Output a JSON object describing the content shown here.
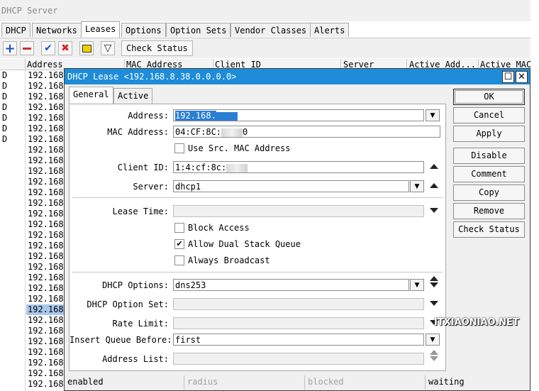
{
  "window": {
    "title": "DHCP Server"
  },
  "tabs": [
    "DHCP",
    "Networks",
    "Leases",
    "Options",
    "Option Sets",
    "Vendor Classes",
    "Alerts"
  ],
  "toolbar": {
    "icons": [
      "add-icon",
      "remove-icon",
      "enable-check-icon",
      "disable-x-icon",
      "comment-icon",
      "filter-icon"
    ],
    "check_status_label": "Check Status",
    "colors": {
      "add": "#1a4fc4",
      "remove": "#d03030",
      "enable": "#1a4fc4",
      "disable": "#e02020",
      "comment": "#f0d000"
    }
  },
  "columns": [
    "Address",
    "MAC Address",
    "Client ID",
    "Server",
    "Active Add...",
    "Active MAC"
  ],
  "rows": [
    {
      "flag": "D",
      "address": "192.168"
    },
    {
      "flag": "D",
      "address": "192.168"
    },
    {
      "flag": "D",
      "address": "192.168"
    },
    {
      "flag": "D",
      "address": "192.168"
    },
    {
      "flag": "D",
      "address": "192.168"
    },
    {
      "flag": "D",
      "address": "192.168"
    },
    {
      "flag": "D",
      "address": "192.168"
    },
    {
      "flag": "",
      "address": "192.168"
    },
    {
      "flag": "",
      "address": "192.168"
    },
    {
      "flag": "",
      "address": "192.168"
    },
    {
      "flag": "",
      "address": "192.168"
    },
    {
      "flag": "",
      "address": "192.168"
    },
    {
      "flag": "",
      "address": "192.168"
    },
    {
      "flag": "",
      "address": "192.168"
    },
    {
      "flag": "",
      "address": "192.168"
    },
    {
      "flag": "",
      "address": "192.168"
    },
    {
      "flag": "",
      "address": "192.168"
    },
    {
      "flag": "",
      "address": "192.168"
    },
    {
      "flag": "",
      "address": "192.168"
    },
    {
      "flag": "",
      "address": "192.168"
    },
    {
      "flag": "",
      "address": "192.168"
    },
    {
      "flag": "",
      "address": "192.168"
    },
    {
      "flag": "",
      "address": "192.168",
      "selected": true
    },
    {
      "flag": "",
      "address": "192.168"
    },
    {
      "flag": "",
      "address": "192.168"
    },
    {
      "flag": "",
      "address": "192.168"
    },
    {
      "flag": "",
      "address": "192.168"
    },
    {
      "flag": "",
      "address": "192.168"
    },
    {
      "flag": "",
      "address": "192.168"
    },
    {
      "flag": "",
      "address": "192.168"
    }
  ],
  "dialog": {
    "title": "DHCP Lease <192.168.8.38.0.0.0.0>",
    "tabs": [
      "General",
      "Active"
    ],
    "fields": {
      "address": {
        "label": "Address:",
        "value": "192.168."
      },
      "mac_address": {
        "label": "MAC Address:",
        "value_prefix": "04:CF:8C:",
        "value_suffix": "0"
      },
      "use_src_mac": {
        "label": "Use Src. MAC Address",
        "checked": false
      },
      "client_id": {
        "label": "Client ID:",
        "value": "1:4:cf:8c:"
      },
      "server": {
        "label": "Server:",
        "value": "dhcp1"
      },
      "lease_time": {
        "label": "Lease Time:",
        "value": ""
      },
      "block_access": {
        "label": "Block Access",
        "checked": false
      },
      "allow_dual_stack_queue": {
        "label": "Allow Dual Stack Queue",
        "checked": true
      },
      "always_broadcast": {
        "label": "Always Broadcast",
        "checked": false
      },
      "dhcp_options": {
        "label": "DHCP Options:",
        "value": "dns253"
      },
      "dhcp_option_set": {
        "label": "DHCP Option Set:",
        "value": ""
      },
      "rate_limit": {
        "label": "Rate Limit:",
        "value": ""
      },
      "insert_queue_before": {
        "label": "Insert Queue Before:",
        "value": "first"
      },
      "address_list": {
        "label": "Address List:",
        "value": ""
      }
    },
    "buttons": [
      "OK",
      "Cancel",
      "Apply",
      "Disable",
      "Comment",
      "Copy",
      "Remove",
      "Check Status"
    ],
    "status": [
      "enabled",
      "radius",
      "blocked",
      "waiting"
    ],
    "title_color": "#1e8cd8"
  },
  "watermark": "ITXIAONIAO.NET"
}
